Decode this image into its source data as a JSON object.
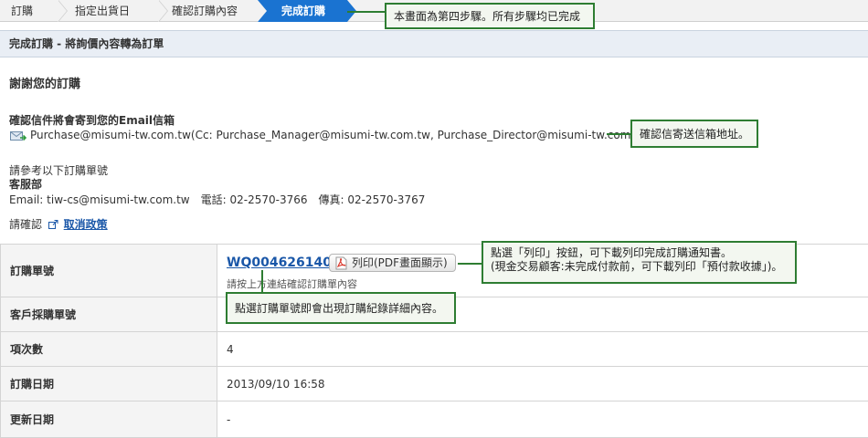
{
  "steps": [
    {
      "label": "訂購"
    },
    {
      "label": "指定出貨日"
    },
    {
      "label": "確認訂購內容"
    },
    {
      "label": "完成訂購"
    }
  ],
  "section_title": "完成訂購 - 將詢價內容轉為訂單",
  "thanks": "謝謝您的訂購",
  "email_block": {
    "title": "確認信件將會寄到您的Email信箱",
    "address": "Purchase@misumi-tw.com.tw(Cc: Purchase_Manager@misumi-tw.com.tw, Purchase_Director@misumi-tw.com.tw)"
  },
  "contact": {
    "ref_text": "請參考以下訂購單號",
    "dept": "客服部",
    "line": "Email: tiw-cs@misumi-tw.com.tw　電話: 02-2570-3766　傳真: 02-2570-3767"
  },
  "cancel": {
    "prefix": "請確認",
    "link": "取消政策"
  },
  "table": {
    "order_no_label": "訂購單號",
    "order_no": "WQ0046261401",
    "print_label": "列印(PDF畫面顯示)",
    "order_hint": "請按上方連結確認訂購單內容",
    "customer_po_label": "客戶採購單號",
    "customer_po": "",
    "items_label": "項次數",
    "items": "4",
    "order_date_label": "訂購日期",
    "order_date": "2013/09/10 16:58",
    "update_date_label": "更新日期",
    "update_date": "-"
  },
  "callouts": {
    "step4": "本畫面為第四步驟。所有步驟均已完成",
    "email": "確認信寄送信箱地址。",
    "print_line1": "點選「列印」按鈕，可下載列印完成訂購通知書。",
    "print_line2": "(現金交易顧客:未完成付款前，可下載列印「預付款收據」)。",
    "order_no": "點選訂購單號即會出現訂購紀錄詳細內容。"
  },
  "colors": {
    "active_step": "#1a73d1",
    "link": "#1a57a8",
    "callout_border": "#2e7d32",
    "pdf_icon": "#d9372b"
  }
}
